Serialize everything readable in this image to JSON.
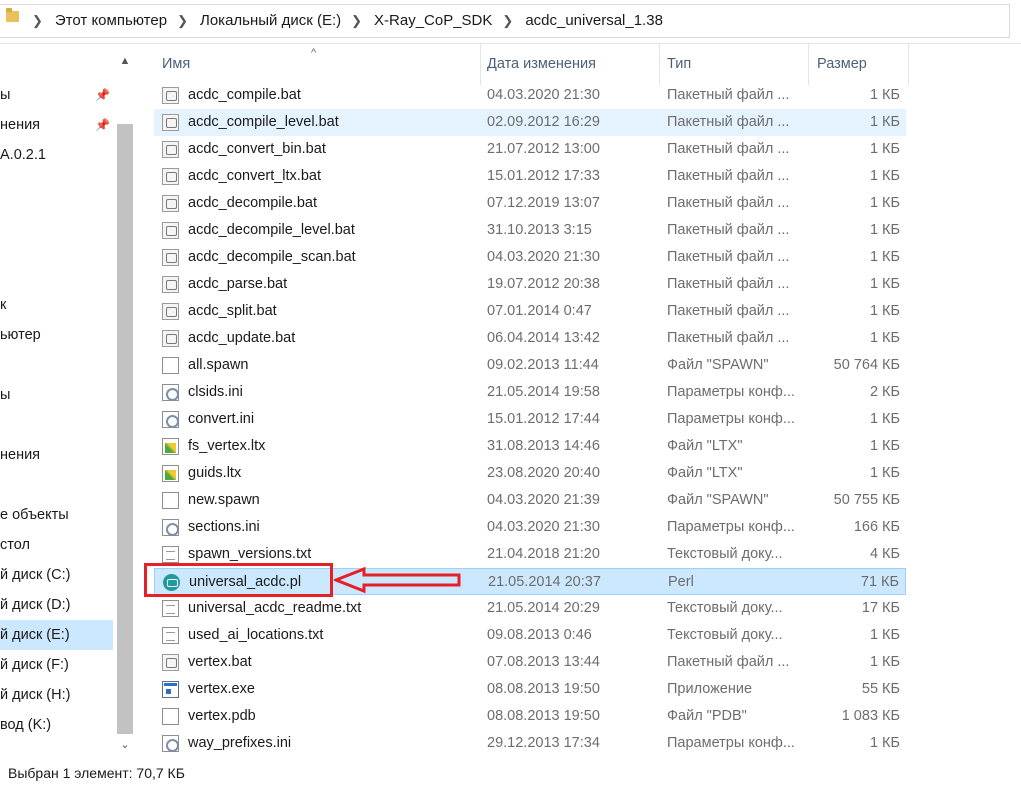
{
  "breadcrumb": {
    "parts": [
      "Этот компьютер",
      "Локальный диск (E:)",
      "X-Ray_CoP_SDK",
      "acdc_universal_1.38"
    ]
  },
  "nav": {
    "items": [
      {
        "label": "ы",
        "pinned": true
      },
      {
        "label": "нения",
        "pinned": true
      },
      {
        "label": "A.0.2.1",
        "pinned": false
      },
      {
        "label": "",
        "pinned": false
      },
      {
        "label": "",
        "pinned": false
      },
      {
        "label": "",
        "pinned": false
      },
      {
        "label": "",
        "pinned": false
      },
      {
        "label": "к",
        "pinned": false
      },
      {
        "label": "ьютер",
        "pinned": false
      },
      {
        "label": "",
        "pinned": false
      },
      {
        "label": "ы",
        "pinned": false
      },
      {
        "label": "",
        "pinned": false
      },
      {
        "label": "нения",
        "pinned": false
      },
      {
        "label": "",
        "pinned": false
      },
      {
        "label": "е объекты",
        "pinned": false
      },
      {
        "label": "стол",
        "pinned": false
      },
      {
        "label": "й диск (C:)",
        "pinned": false
      },
      {
        "label": "й диск (D:)",
        "pinned": false
      },
      {
        "label": "й диск (E:)",
        "pinned": false,
        "selected": true
      },
      {
        "label": "й диск (F:)",
        "pinned": false
      },
      {
        "label": "й диск (H:)",
        "pinned": false
      },
      {
        "label": "вод (K:)",
        "pinned": false
      }
    ]
  },
  "columns": {
    "name": "Имя",
    "date": "Дата изменения",
    "type": "Тип",
    "size": "Размер"
  },
  "files": [
    {
      "name": "acdc_compile.bat",
      "date": "04.03.2020 21:30",
      "type": "Пакетный файл ...",
      "size": "1 КБ",
      "icon": "bat"
    },
    {
      "name": "acdc_compile_level.bat",
      "date": "02.09.2012 16:29",
      "type": "Пакетный файл ...",
      "size": "1 КБ",
      "icon": "bat",
      "hover": true
    },
    {
      "name": "acdc_convert_bin.bat",
      "date": "21.07.2012 13:00",
      "type": "Пакетный файл ...",
      "size": "1 КБ",
      "icon": "bat"
    },
    {
      "name": "acdc_convert_ltx.bat",
      "date": "15.01.2012 17:33",
      "type": "Пакетный файл ...",
      "size": "1 КБ",
      "icon": "bat"
    },
    {
      "name": "acdc_decompile.bat",
      "date": "07.12.2019 13:07",
      "type": "Пакетный файл ...",
      "size": "1 КБ",
      "icon": "bat"
    },
    {
      "name": "acdc_decompile_level.bat",
      "date": "31.10.2013 3:15",
      "type": "Пакетный файл ...",
      "size": "1 КБ",
      "icon": "bat"
    },
    {
      "name": "acdc_decompile_scan.bat",
      "date": "04.03.2020 21:30",
      "type": "Пакетный файл ...",
      "size": "1 КБ",
      "icon": "bat"
    },
    {
      "name": "acdc_parse.bat",
      "date": "19.07.2012 20:38",
      "type": "Пакетный файл ...",
      "size": "1 КБ",
      "icon": "bat"
    },
    {
      "name": "acdc_split.bat",
      "date": "07.01.2014 0:47",
      "type": "Пакетный файл ...",
      "size": "1 КБ",
      "icon": "bat"
    },
    {
      "name": "acdc_update.bat",
      "date": "06.04.2014 13:42",
      "type": "Пакетный файл ...",
      "size": "1 КБ",
      "icon": "bat"
    },
    {
      "name": "all.spawn",
      "date": "09.02.2013 11:44",
      "type": "Файл \"SPAWN\"",
      "size": "50 764 КБ",
      "icon": "file"
    },
    {
      "name": "clsids.ini",
      "date": "21.05.2014 19:58",
      "type": "Параметры конф...",
      "size": "2 КБ",
      "icon": "ini"
    },
    {
      "name": "convert.ini",
      "date": "15.01.2012 17:44",
      "type": "Параметры конф...",
      "size": "1 КБ",
      "icon": "ini"
    },
    {
      "name": "fs_vertex.ltx",
      "date": "31.08.2013 14:46",
      "type": "Файл \"LTX\"",
      "size": "1 КБ",
      "icon": "ltx"
    },
    {
      "name": "guids.ltx",
      "date": "23.08.2020 20:40",
      "type": "Файл \"LTX\"",
      "size": "1 КБ",
      "icon": "ltx"
    },
    {
      "name": "new.spawn",
      "date": "04.03.2020 21:39",
      "type": "Файл \"SPAWN\"",
      "size": "50 755 КБ",
      "icon": "file"
    },
    {
      "name": "sections.ini",
      "date": "04.03.2020 21:30",
      "type": "Параметры конф...",
      "size": "166 КБ",
      "icon": "ini"
    },
    {
      "name": "spawn_versions.txt",
      "date": "21.04.2018 21:20",
      "type": "Текстовый доку...",
      "size": "4 КБ",
      "icon": "txt"
    },
    {
      "name": "universal_acdc.pl",
      "date": "21.05.2014 20:37",
      "type": "Perl",
      "size": "71 КБ",
      "icon": "perl",
      "selected": true
    },
    {
      "name": "universal_acdc_readme.txt",
      "date": "21.05.2014 20:29",
      "type": "Текстовый доку...",
      "size": "17 КБ",
      "icon": "txt"
    },
    {
      "name": "used_ai_locations.txt",
      "date": "09.08.2013 0:46",
      "type": "Текстовый доку...",
      "size": "1 КБ",
      "icon": "txt"
    },
    {
      "name": "vertex.bat",
      "date": "07.08.2013 13:44",
      "type": "Пакетный файл ...",
      "size": "1 КБ",
      "icon": "bat"
    },
    {
      "name": "vertex.exe",
      "date": "08.08.2013 19:50",
      "type": "Приложение",
      "size": "55 КБ",
      "icon": "exe"
    },
    {
      "name": "vertex.pdb",
      "date": "08.08.2013 19:50",
      "type": "Файл \"PDB\"",
      "size": "1 083 КБ",
      "icon": "file"
    },
    {
      "name": "way_prefixes.ini",
      "date": "29.12.2013 17:34",
      "type": "Параметры конф...",
      "size": "1 КБ",
      "icon": "ini"
    }
  ],
  "status": {
    "text": "Выбран 1 элемент: 70,7 КБ"
  },
  "colors": {
    "selection": "#cce8ff",
    "hover": "#e5f3ff",
    "annotation": "#e52128"
  }
}
